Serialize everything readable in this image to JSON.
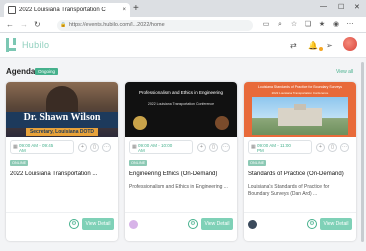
{
  "browser": {
    "tab_title": "2022 Louisiana Transportation C",
    "tab_close": "×",
    "new_tab": "+",
    "url": "https://events.hubilo.com/l...2022/home",
    "window_controls": [
      "—",
      "☐",
      "✕"
    ],
    "nav": [
      "←",
      "→",
      "↻"
    ]
  },
  "app": {
    "brand": "Hubilo",
    "accent": "#45b08c"
  },
  "agenda": {
    "title": "Agenda",
    "badge": "Ongoing",
    "view_all": "View all"
  },
  "cards": [
    {
      "thumb_text": "Dr. Shawn Wilson",
      "thumb_sub": "Secretary, Louisiana DOTD",
      "date_line1": "09:00 AM - 09:45",
      "date_line2": "AM",
      "tag": "ONLINE",
      "title": "2022 Louisiana Transportation ...",
      "subtitle": "",
      "button": "View Detail",
      "gear": "⚙"
    },
    {
      "thumb_text": "Professionalism and Ethics in Engineering",
      "thumb_sub": "2022 Louisiana Transportation Conference",
      "date_line1": "09:00 AM - 10:00",
      "date_line2": "AM",
      "tag": "ONLINE",
      "title": "Engineering Ethics (On-Demand)",
      "subtitle": "Professionalism and Ethics in Engineering ...",
      "button": "View Detail",
      "gear": "⚙"
    },
    {
      "thumb_text": "Louisiana Standards of Practice for Boundary Surveys",
      "thumb_sub": "2022 Louisiana Transportation Conference",
      "date_line1": "09:00 AM - 11:00",
      "date_line2": "PM",
      "tag": "ONLINE",
      "title": "Standards of Practice (On-Demand)",
      "subtitle": "Louisiana's Standards of Practice for Boundary Surveys (Dan Ard) ...",
      "button": "View Detail",
      "gear": "⚙"
    }
  ]
}
